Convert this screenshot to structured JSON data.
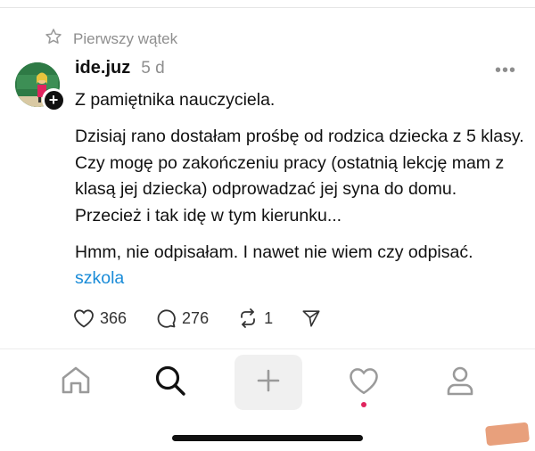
{
  "repost": {
    "label": "Pierwszy wątek",
    "icon": "star-icon"
  },
  "post": {
    "username": "ide.juz",
    "time": "5 d",
    "more": "•••",
    "paragraph1": "Z pamiętnika nauczyciela.",
    "paragraph2": "Dzisiaj rano dostałam prośbę od rodzica dziecka z 5 klasy. Czy mogę po zakończeniu pracy (ostatnią lekcję mam z klasą jej dziecka) odprowadzać jej syna do domu. Przecież i tak idę w tym kierunku...",
    "paragraph3": "Hmm, nie odpisałam. I nawet nie wiem czy odpisać.",
    "tag": "szkola",
    "likes": "366",
    "replies": "276",
    "reposts": "1"
  },
  "nav": {
    "items": [
      "home-icon",
      "search-icon",
      "plus-icon",
      "heart-icon",
      "user-icon"
    ],
    "active": "search",
    "notification_dot_color": "#e0245e"
  },
  "colors": {
    "link": "#1a8cd8",
    "muted": "#8e8e8e",
    "text": "#111111"
  }
}
